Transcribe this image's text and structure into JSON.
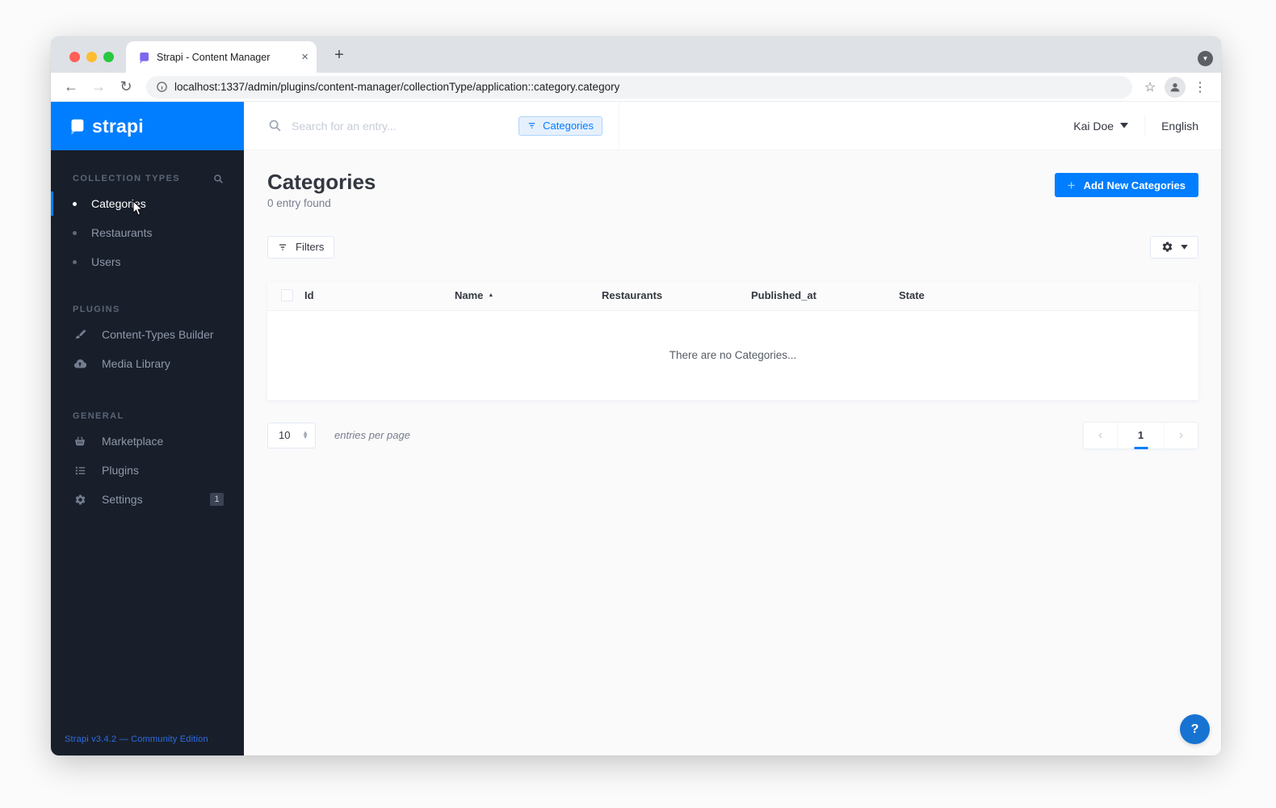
{
  "browser": {
    "tab_title": "Strapi - Content Manager",
    "url": "localhost:1337/admin/plugins/content-manager/collectionType/application::category.category",
    "close_glyph": "×",
    "new_tab_glyph": "+",
    "back_glyph": "←",
    "forward_glyph": "→",
    "reload_glyph": "↻",
    "star_glyph": "☆",
    "menu_glyph": "⋮",
    "downloads_glyph": "▼"
  },
  "topbar": {
    "search_placeholder": "Search for an entry...",
    "filter_chip_label": "Categories",
    "user_name": "Kai Doe",
    "language": "English"
  },
  "sidebar": {
    "logo_text": "strapi",
    "sections": [
      {
        "title": "COLLECTION TYPES",
        "items": [
          {
            "label": "Categories"
          },
          {
            "label": "Restaurants"
          },
          {
            "label": "Users"
          }
        ]
      },
      {
        "title": "PLUGINS",
        "items": [
          {
            "label": "Content-Types Builder"
          },
          {
            "label": "Media Library"
          }
        ]
      },
      {
        "title": "GENERAL",
        "items": [
          {
            "label": "Marketplace"
          },
          {
            "label": "Plugins"
          },
          {
            "label": "Settings",
            "badge": "1"
          }
        ]
      }
    ],
    "footer": "Strapi v3.4.2 — Community Edition"
  },
  "content": {
    "title": "Categories",
    "entry_count": "0 entry found",
    "add_button_label": "Add New Categories",
    "add_button_plus": "+",
    "filters_label": "Filters",
    "table": {
      "columns": [
        "Id",
        "Name",
        "Restaurants",
        "Published_at",
        "State"
      ],
      "sorted_column": "Name",
      "sort_direction": "asc",
      "sort_glyph": "▲",
      "empty_message": "There are no Categories..."
    },
    "pagination": {
      "entries_per_page": "10",
      "entries_label": "entries per page",
      "current_page": "1",
      "prev_glyph": "‹",
      "next_glyph": "›"
    },
    "help_label": "?"
  },
  "colors": {
    "accent_blue": "#007eff",
    "sidebar_bg": "#181f2b",
    "content_bg": "#fafafb",
    "chip_bg": "#e6f0fd",
    "help_fab": "#1773d2"
  }
}
